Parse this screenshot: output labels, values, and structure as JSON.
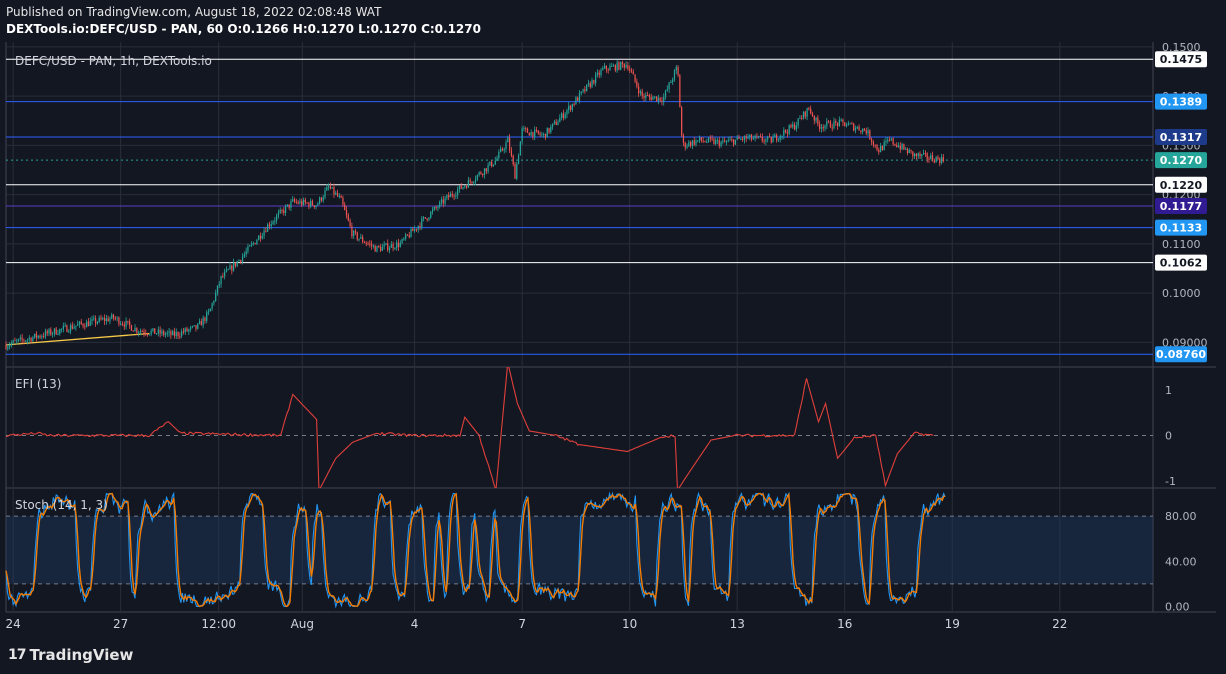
{
  "header": {
    "published": "Published on TradingView.com, August 18, 2022 02:08:48 WAT",
    "symbol_line": "DEXTools.io:DEFC/USD - PAN, 60 O:0.1266 H:0.1270 L:0.1270 C:0.1270"
  },
  "footer": {
    "brand": "TradingView",
    "logo": "17"
  },
  "colors": {
    "background": "#131722",
    "grid": "#2a2e39",
    "up_candle": "#26a69a",
    "down_candle": "#ef5350",
    "efi_line": "#e0403a",
    "stoch_k": "#2196f3",
    "stoch_d": "#f57c00",
    "level_blue": "#2962ff",
    "level_white": "#ffffff",
    "trendline": "#f7c948"
  },
  "chart_data": [
    {
      "type": "candlestick",
      "title": "DEFC/USD - PAN, 1h, DEXTools.io",
      "ylim": [
        0.085,
        0.151
      ],
      "y_ticks": [
        "0.1500",
        "0.1400",
        "0.1300",
        "0.1200",
        "0.1100",
        "0.1000",
        "0.09000"
      ],
      "y_tick_values": [
        0.15,
        0.14,
        0.13,
        0.12,
        0.11,
        0.1,
        0.09
      ],
      "x_ticks": [
        "24",
        "27",
        "12:00",
        "Aug",
        "4",
        "7",
        "10",
        "13",
        "16",
        "19",
        "22"
      ],
      "close_path": [
        [
          0,
          0.0895
        ],
        [
          3,
          0.0935
        ],
        [
          4.5,
          0.095
        ],
        [
          5.5,
          0.0925
        ],
        [
          7,
          0.0915
        ],
        [
          8,
          0.093
        ],
        [
          8.5,
          0.096
        ],
        [
          9,
          0.103
        ],
        [
          10,
          0.108
        ],
        [
          11,
          0.114
        ],
        [
          12,
          0.1185
        ],
        [
          13,
          0.118
        ],
        [
          13.5,
          0.1215
        ],
        [
          14,
          0.119
        ],
        [
          14.5,
          0.112
        ],
        [
          15.5,
          0.109
        ],
        [
          16.5,
          0.11
        ],
        [
          17.5,
          0.115
        ],
        [
          18.5,
          0.1195
        ],
        [
          19.5,
          0.123
        ],
        [
          20.5,
          0.127
        ],
        [
          21,
          0.131
        ],
        [
          21.3,
          0.124
        ],
        [
          21.6,
          0.133
        ],
        [
          22.5,
          0.132
        ],
        [
          23,
          0.1345
        ],
        [
          24,
          0.14
        ],
        [
          25,
          0.1455
        ],
        [
          26,
          0.1465
        ],
        [
          26.6,
          0.14
        ],
        [
          27.5,
          0.1395
        ],
        [
          28.1,
          0.146
        ],
        [
          28.3,
          0.13
        ],
        [
          29,
          0.131
        ],
        [
          30,
          0.1305
        ],
        [
          31,
          0.1315
        ],
        [
          32,
          0.131
        ],
        [
          33,
          0.134
        ],
        [
          33.6,
          0.1375
        ],
        [
          34,
          0.134
        ],
        [
          35,
          0.1345
        ],
        [
          36,
          0.133
        ],
        [
          36.5,
          0.129
        ],
        [
          37,
          0.131
        ],
        [
          38,
          0.128
        ],
        [
          39.3,
          0.127
        ]
      ],
      "levels": [
        {
          "value": 0.1475,
          "label": "0.1475",
          "style": "white"
        },
        {
          "value": 0.1389,
          "label": "0.1389",
          "style": "blue"
        },
        {
          "value": 0.1317,
          "label": "0.1317",
          "style": "navy"
        },
        {
          "value": 0.127,
          "label": "0.1270",
          "style": "teal"
        },
        {
          "value": 0.122,
          "label": "0.1220",
          "style": "white"
        },
        {
          "value": 0.1177,
          "label": "0.1177",
          "style": "purple"
        },
        {
          "value": 0.1133,
          "label": "0.1133",
          "style": "blue"
        },
        {
          "value": 0.1062,
          "label": "0.1062",
          "style": "white"
        },
        {
          "value": 0.0876,
          "label": "0.08760",
          "style": "blue"
        }
      ],
      "trendline": [
        [
          0,
          0.0895
        ],
        [
          6,
          0.0918
        ]
      ]
    },
    {
      "type": "line",
      "title": "EFI (13)",
      "ylim": [
        -1.15,
        1.5
      ],
      "y_ticks": [
        "1",
        "0",
        "-1"
      ],
      "y_tick_values": [
        1,
        0,
        -1
      ],
      "series": [
        {
          "values": [
            [
              0,
              0
            ],
            [
              1.3,
              0.05
            ],
            [
              1.8,
              0
            ],
            [
              6,
              0
            ],
            [
              6.8,
              0.3
            ],
            [
              7.3,
              0.05
            ],
            [
              11.5,
              0
            ],
            [
              12,
              0.9
            ],
            [
              13,
              0.35
            ],
            [
              13.1,
              -1.2
            ],
            [
              13.8,
              -0.5
            ],
            [
              14.5,
              -0.15
            ],
            [
              15.5,
              0.05
            ],
            [
              17,
              0
            ],
            [
              19,
              0
            ],
            [
              19.2,
              0.4
            ],
            [
              19.8,
              0
            ],
            [
              20.5,
              -1.2
            ],
            [
              21,
              1.6
            ],
            [
              21.4,
              0.7
            ],
            [
              21.9,
              0.1
            ],
            [
              23,
              0
            ],
            [
              24,
              -0.2
            ],
            [
              26,
              -0.35
            ],
            [
              27.5,
              -0.02
            ],
            [
              28,
              0
            ],
            [
              28.1,
              -1.2
            ],
            [
              28.6,
              -0.8
            ],
            [
              29.5,
              -0.1
            ],
            [
              30.5,
              0
            ],
            [
              33,
              0
            ],
            [
              33.5,
              1.25
            ],
            [
              34,
              0.3
            ],
            [
              34.3,
              0.7
            ],
            [
              34.8,
              -0.5
            ],
            [
              35.5,
              -0.05
            ],
            [
              36.4,
              0
            ],
            [
              36.8,
              -1.1
            ],
            [
              37.3,
              -0.4
            ],
            [
              38,
              0.05
            ],
            [
              38.8,
              0
            ]
          ]
        }
      ]
    },
    {
      "type": "line",
      "title": "Stoch (14, 1, 3)",
      "ylim": [
        -5,
        105
      ],
      "y_ticks": [
        "80.00",
        "40.00",
        "0.00"
      ],
      "y_tick_values": [
        80,
        40,
        0
      ],
      "bands": [
        20,
        80
      ],
      "series": [
        {
          "name": "%K",
          "color": "#2196f3"
        },
        {
          "name": "%D",
          "color": "#f57c00"
        }
      ]
    }
  ]
}
